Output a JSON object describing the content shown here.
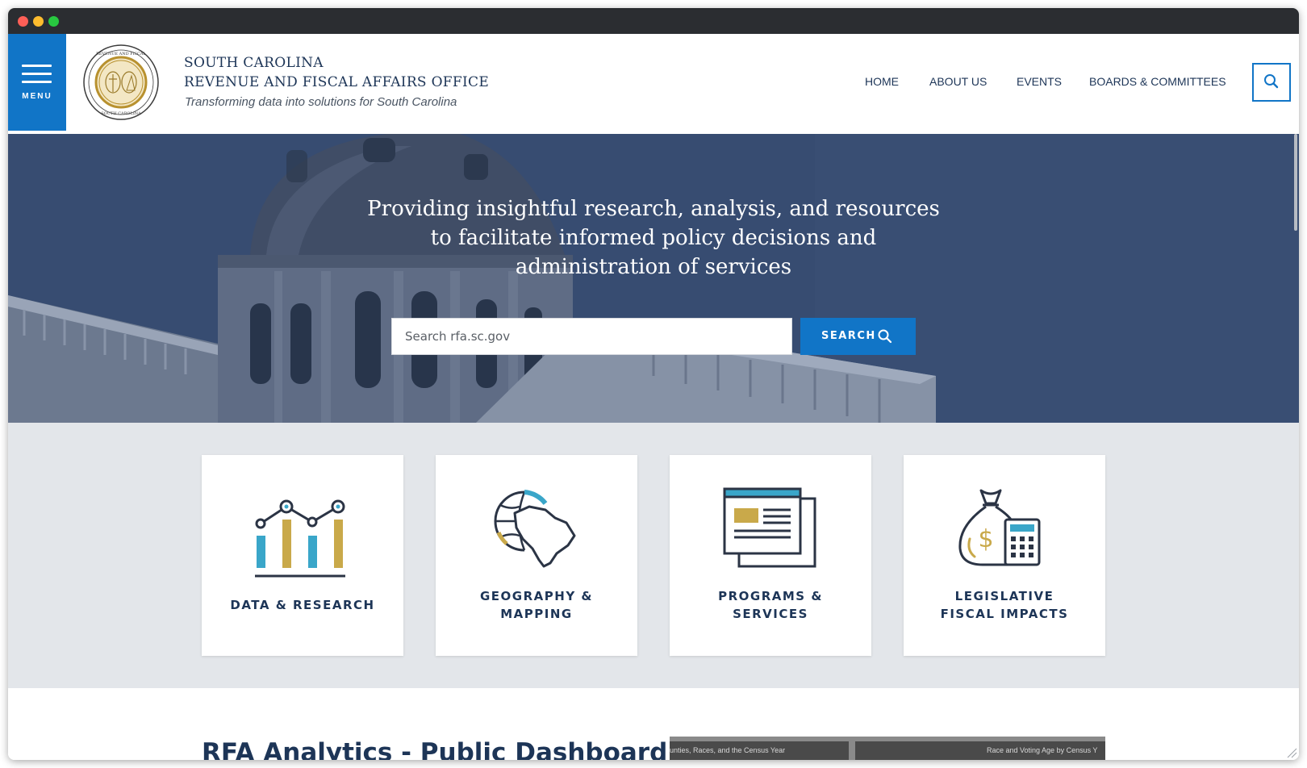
{
  "window": {
    "controls": [
      "close",
      "minimize",
      "maximize"
    ]
  },
  "header": {
    "menu_label": "MENU",
    "brand_line1": "SOUTH CAROLINA",
    "brand_line2": "REVENUE AND FISCAL AFFAIRS OFFICE",
    "tagline": "Transforming data into solutions for South Carolina",
    "seal_text": "REVENUE AND FISCAL AFFAIRS OFFICE · SOUTH CAROLINA",
    "nav": [
      "HOME",
      "ABOUT US",
      "EVENTS",
      "BOARDS & COMMITTEES"
    ],
    "search_icon": "search-icon"
  },
  "hero": {
    "lines": [
      "Providing insightful research, analysis, and resources",
      "to facilitate informed policy decisions and",
      "administration of services"
    ],
    "search_placeholder": "Search rfa.sc.gov",
    "search_button": "SEARCH"
  },
  "cards": [
    {
      "label_lines": [
        "DATA & RESEARCH"
      ],
      "icon": "bar-chart-icon"
    },
    {
      "label_lines": [
        "GEOGRAPHY &",
        "MAPPING"
      ],
      "icon": "globe-map-icon"
    },
    {
      "label_lines": [
        "PROGRAMS &",
        "SERVICES"
      ],
      "icon": "documents-icon"
    },
    {
      "label_lines": [
        "LEGISLATIVE",
        "FISCAL IMPACTS"
      ],
      "icon": "money-calculator-icon"
    }
  ],
  "dashboard": {
    "title": "RFA Analytics - Public Dashboard",
    "thumb_caption_left": "unties, Races, and the Census Year",
    "thumb_caption_right": "Race and Voting Age by Census Y"
  },
  "colors": {
    "primary": "#1175c7",
    "navy": "#1d3557",
    "gold": "#c9a94a",
    "teal": "#3aa6c9",
    "band": "#e3e6ea"
  }
}
